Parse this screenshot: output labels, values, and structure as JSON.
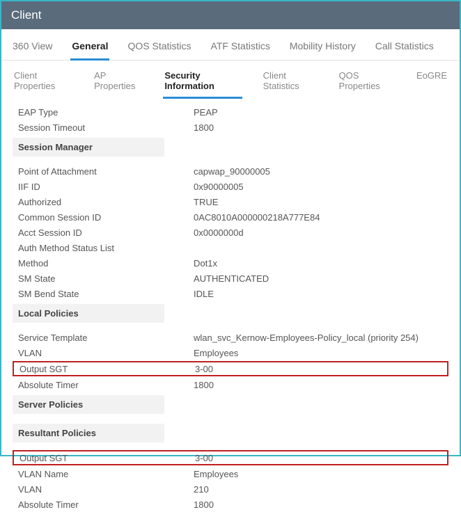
{
  "window": {
    "title": "Client"
  },
  "tabs": {
    "view360": "360 View",
    "general": "General",
    "qos_stats": "QOS Statistics",
    "atf_stats": "ATF Statistics",
    "mobility": "Mobility History",
    "call_stats": "Call Statistics"
  },
  "subtabs": {
    "client_props": "Client Properties",
    "ap_props": "AP Properties",
    "security_info": "Security Information",
    "client_stats": "Client Statistics",
    "qos_props": "QOS Properties",
    "eogre": "EoGRE"
  },
  "top_rows": {
    "eap_type": {
      "label": "EAP Type",
      "value": "PEAP"
    },
    "session_timeout": {
      "label": "Session Timeout",
      "value": "1800"
    }
  },
  "session_manager": {
    "header": "Session Manager",
    "point_of_attachment": {
      "label": "Point of Attachment",
      "value": "capwap_90000005"
    },
    "iif_id": {
      "label": "IIF ID",
      "value": "0x90000005"
    },
    "authorized": {
      "label": "Authorized",
      "value": "TRUE"
    },
    "common_session_id": {
      "label": "Common Session ID",
      "value": "0AC8010A000000218A777E84"
    },
    "acct_session_id": {
      "label": "Acct Session ID",
      "value": "0x0000000d"
    },
    "auth_method_status": {
      "label": "Auth Method Status List",
      "value": ""
    },
    "method": {
      "label": "Method",
      "value": "Dot1x"
    },
    "sm_state": {
      "label": "SM State",
      "value": "AUTHENTICATED"
    },
    "sm_bend_state": {
      "label": "SM Bend State",
      "value": "IDLE"
    }
  },
  "local_policies": {
    "header": "Local Policies",
    "service_template": {
      "label": "Service Template",
      "value": "wlan_svc_Kernow-Employees-Policy_local (priority 254)"
    },
    "vlan": {
      "label": "VLAN",
      "value": "Employees"
    },
    "output_sgt": {
      "label": "Output SGT",
      "value": "3-00"
    },
    "absolute_timer": {
      "label": "Absolute Timer",
      "value": "1800"
    }
  },
  "server_policies": {
    "header": "Server Policies"
  },
  "resultant_policies": {
    "header": "Resultant Policies",
    "output_sgt": {
      "label": "Output SGT",
      "value": "3-00"
    },
    "vlan_name": {
      "label": "VLAN Name",
      "value": "Employees"
    },
    "vlan": {
      "label": "VLAN",
      "value": "210"
    },
    "absolute_timer": {
      "label": "Absolute Timer",
      "value": "1800"
    }
  }
}
